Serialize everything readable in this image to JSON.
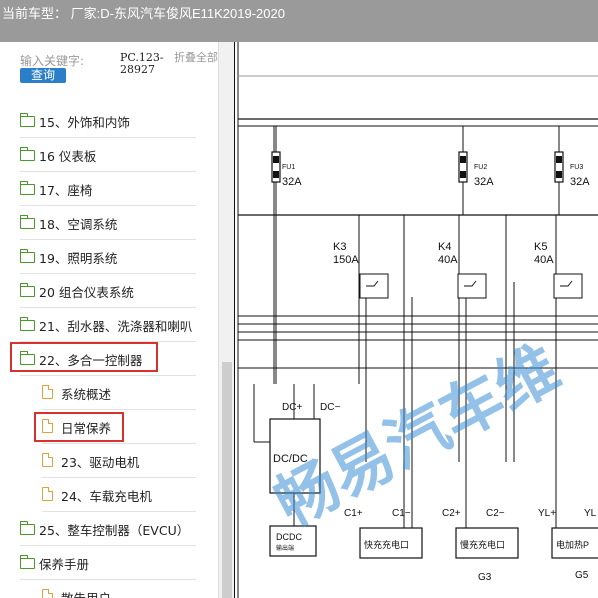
{
  "header": {
    "title": "当前车型：  厂家:D-东风汽车俊风E11K2019-2020"
  },
  "search": {
    "keyword_label": "输入关键字:",
    "keyword_value": "PC.123-28927",
    "collapse_label": "折叠全部",
    "query_button": "查询"
  },
  "tree": [
    {
      "label": "15、外饰和内饰",
      "type": "folder",
      "level": 0
    },
    {
      "label": "16 仪表板",
      "type": "folder",
      "level": 0
    },
    {
      "label": "17、座椅",
      "type": "folder",
      "level": 0
    },
    {
      "label": "18、空调系统",
      "type": "folder",
      "level": 0
    },
    {
      "label": "19、照明系统",
      "type": "folder",
      "level": 0
    },
    {
      "label": "20 组合仪表系统",
      "type": "folder",
      "level": 0
    },
    {
      "label": "21、刮水器、洗涤器和喇叭",
      "type": "folder",
      "level": 0
    },
    {
      "label": "22、多合一控制器",
      "type": "folder",
      "level": 0,
      "highlighted": true
    },
    {
      "label": "系统概述",
      "type": "file",
      "level": 1
    },
    {
      "label": "日常保养",
      "type": "file",
      "level": 1,
      "highlighted": true
    },
    {
      "label": "23、驱动电机",
      "type": "file",
      "level": 1
    },
    {
      "label": "24、车载充电机",
      "type": "file",
      "level": 1
    },
    {
      "label": "25、整车控制器（EVCU）",
      "type": "folder",
      "level": 0
    },
    {
      "label": "保养手册",
      "type": "folder",
      "level": 0
    },
    {
      "label": "散告用户",
      "type": "file",
      "level": 1
    }
  ],
  "diagram": {
    "fuses": [
      {
        "name": "FU1",
        "rating": "32A"
      },
      {
        "name": "FU2",
        "rating": "32A"
      },
      {
        "name": "FU3",
        "rating": "32A"
      }
    ],
    "relays": [
      {
        "name": "K3",
        "rating": "150A"
      },
      {
        "name": "K4",
        "rating": "40A"
      },
      {
        "name": "K5",
        "rating": "40A"
      }
    ],
    "dcdc": {
      "label": "DC/DC",
      "plus": "DC+",
      "minus": "DC−"
    },
    "pins": [
      "C1+",
      "C1−",
      "C2+",
      "C2−",
      "YL+",
      "YL"
    ],
    "boxes": [
      {
        "line1": "DCDC",
        "line2": "输出端"
      },
      {
        "line1": "快充充电口",
        "line2": ""
      },
      {
        "line1": "慢充充电口",
        "line2": ""
      },
      {
        "line1": "电加热P",
        "line2": ""
      }
    ],
    "ground_labels": [
      "G3",
      "G5"
    ],
    "watermark": "畅易汽车维"
  },
  "colors": {
    "highlight": "#d9312c",
    "folder": "#4a9a2a",
    "file": "#e0a040",
    "button": "#2b7fc9",
    "watermark": "#3b8fd6"
  }
}
